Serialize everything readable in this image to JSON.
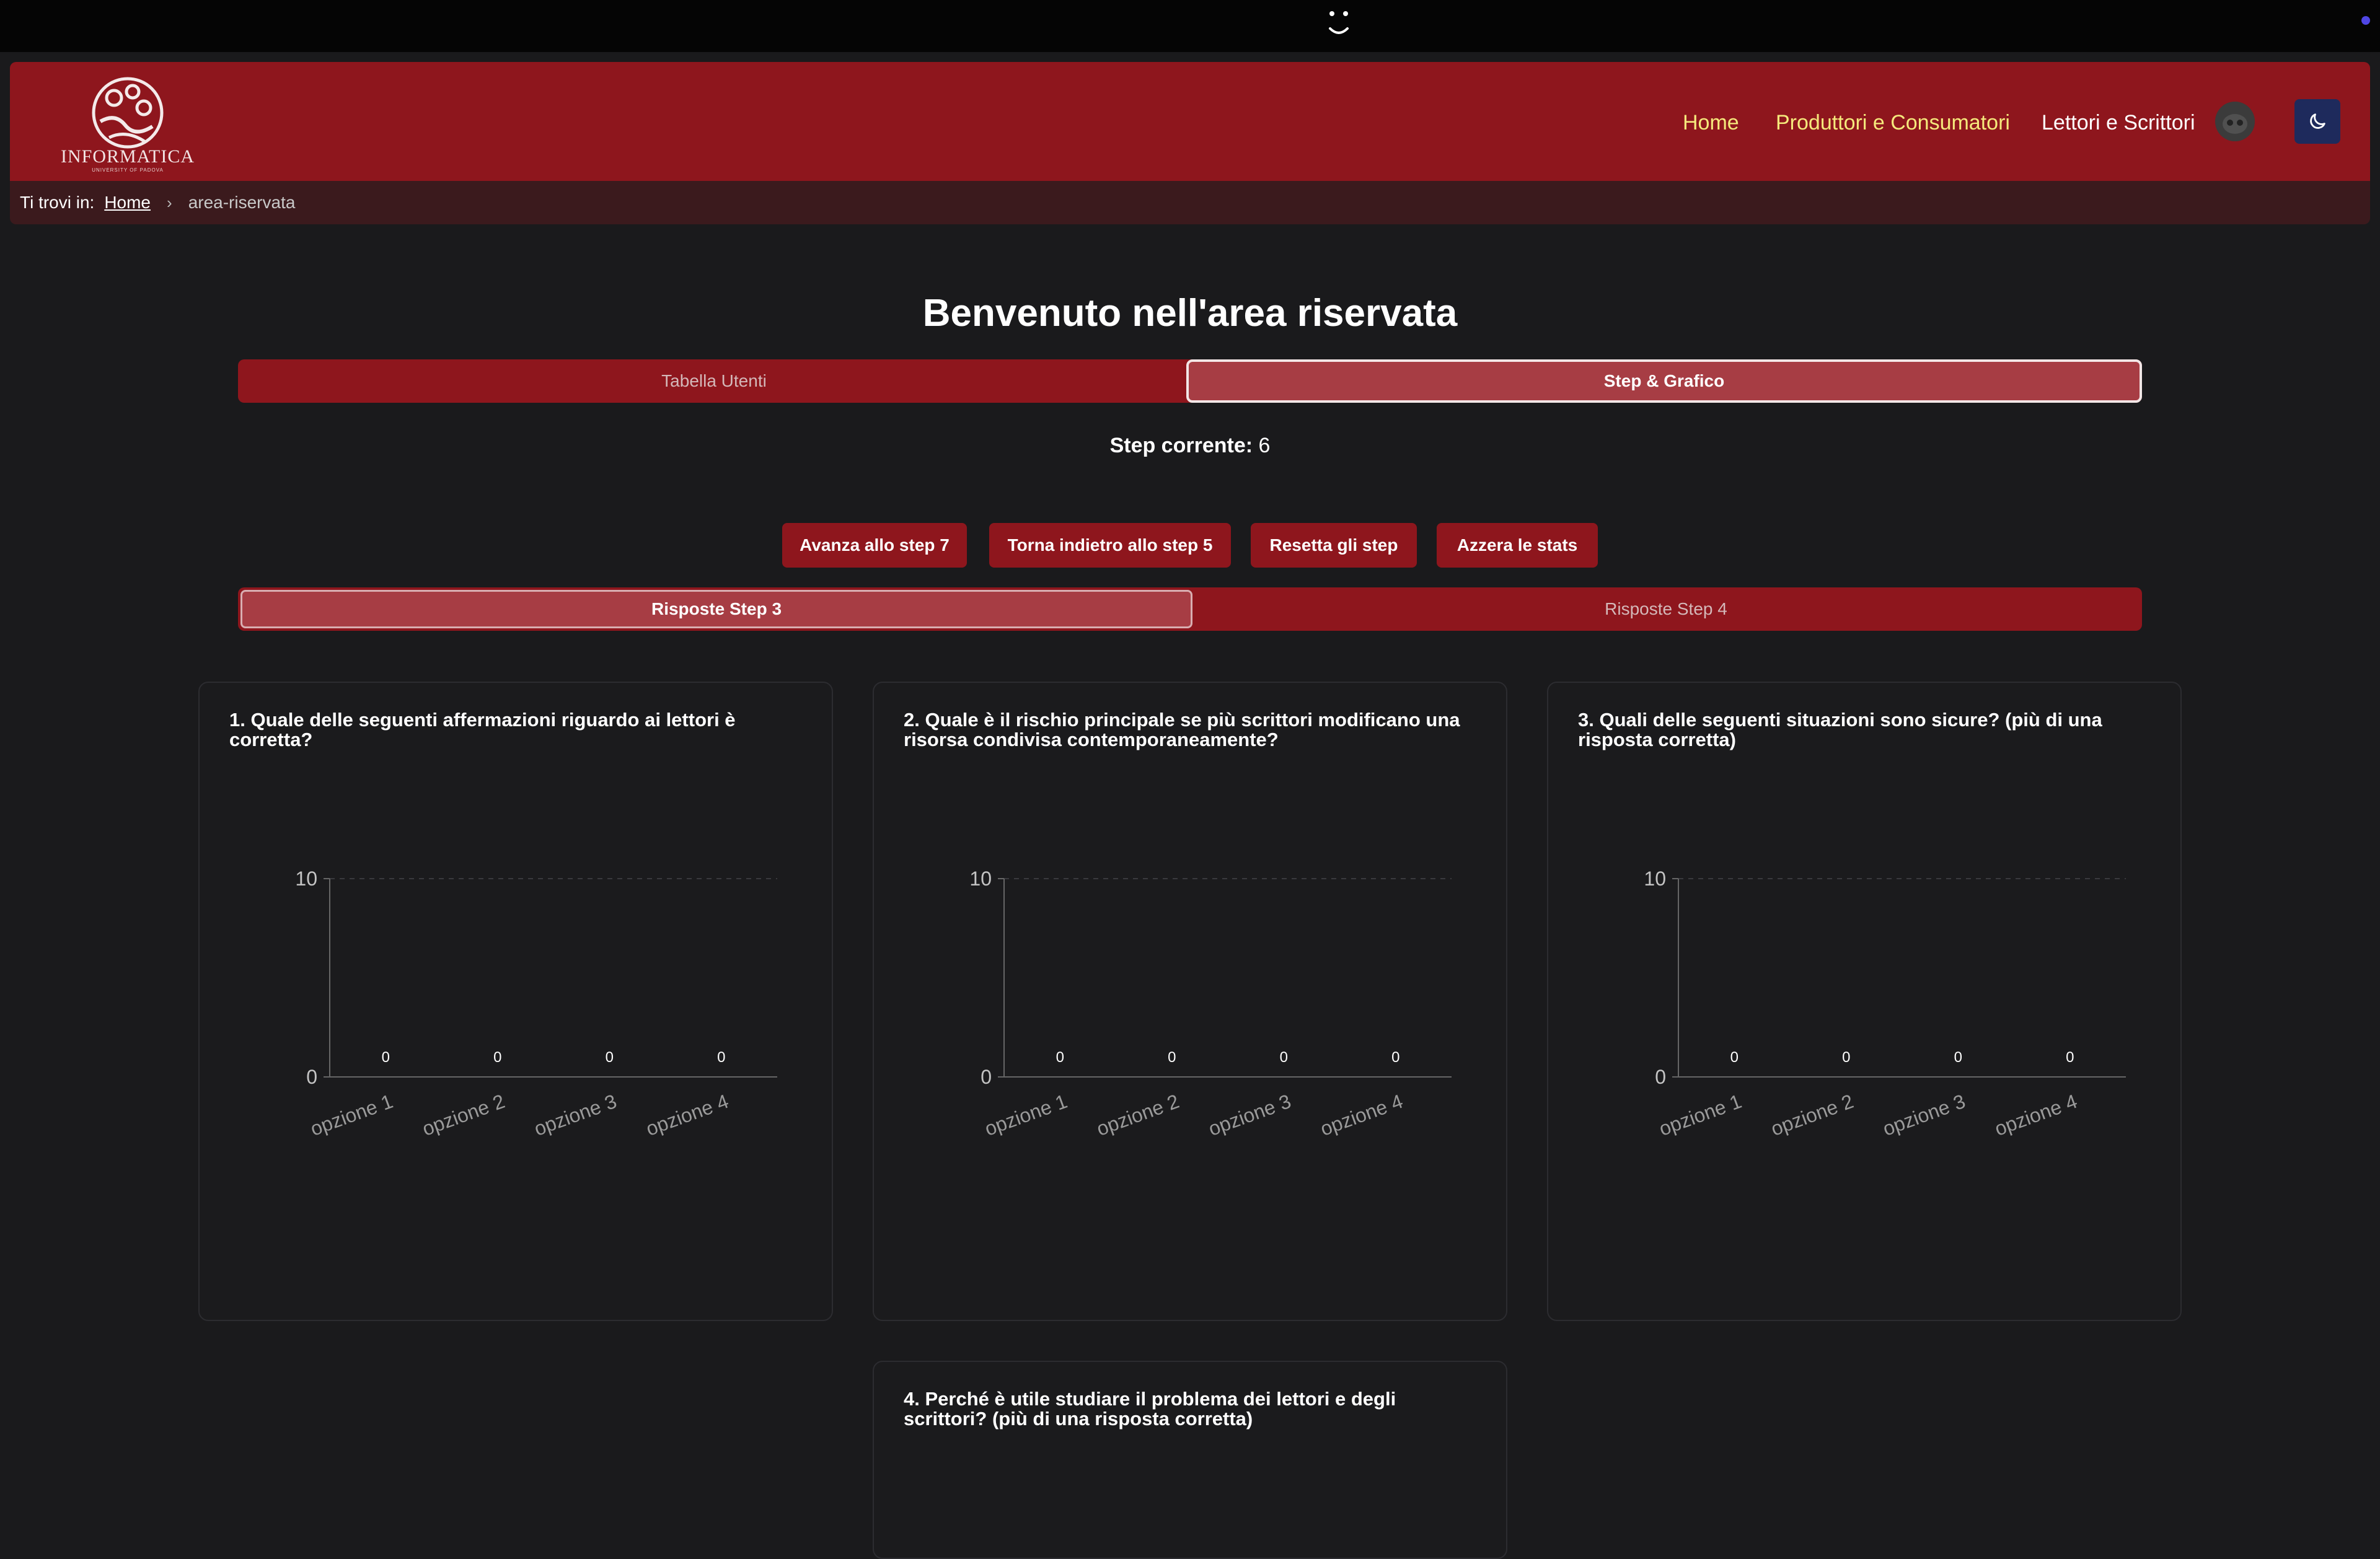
{
  "os": {
    "face_icon": "smiley-face-icon"
  },
  "navbar": {
    "logo_text": "INFORMATICA",
    "logo_subtext": "UNIVERSITY OF PADOVA",
    "links": [
      "Home",
      "Produttori e Consumatori",
      "Lettori e Scrittori"
    ],
    "link_colors": {
      "yellow": "#f5e97c",
      "white": "#ffffff"
    },
    "theme_icon": "moon-icon",
    "accent": "#8e161d"
  },
  "breadcrumb": {
    "prefix": "Ti trovi in:",
    "home": "Home",
    "current": "area-riservata"
  },
  "page": {
    "title": "Benvenuto nell'area riservata",
    "main_tabs": [
      "Tabella Utenti",
      "Step & Grafico"
    ],
    "active_main_tab": "Step & Grafico",
    "step_label": "Step corrente:",
    "step_value": "6",
    "buttons": [
      "Avanza allo step 7",
      "Torna indietro allo step 5",
      "Resetta gli step",
      "Azzera le stats"
    ],
    "response_tabs": [
      "Risposte Step 3",
      "Risposte Step 4"
    ],
    "active_response_tab": "Risposte Step 3"
  },
  "questions": [
    {
      "title": "1. Quale delle seguenti affermazioni riguardo ai lettori è corretta?"
    },
    {
      "title": "2. Quale è il rischio principale se più scrittori modificano una risorsa condivisa contemporaneamente?"
    },
    {
      "title": "3. Quali delle seguenti situazioni sono sicure? (più di una risposta corretta)"
    },
    {
      "title": "4. Perché è utile studiare il problema dei lettori e degli scrittori? (più di una risposta corretta)"
    }
  ],
  "chart_data": [
    {
      "type": "bar",
      "categories": [
        "opzione 1",
        "opzione 2",
        "opzione 3",
        "opzione 4"
      ],
      "values": [
        0,
        0,
        0,
        0
      ],
      "ylim": [
        0,
        10
      ],
      "yticks": [
        0,
        10
      ],
      "grid": true
    },
    {
      "type": "bar",
      "categories": [
        "opzione 1",
        "opzione 2",
        "opzione 3",
        "opzione 4"
      ],
      "values": [
        0,
        0,
        0,
        0
      ],
      "ylim": [
        0,
        10
      ],
      "yticks": [
        0,
        10
      ],
      "grid": true
    },
    {
      "type": "bar",
      "categories": [
        "opzione 1",
        "opzione 2",
        "opzione 3",
        "opzione 4"
      ],
      "values": [
        0,
        0,
        0,
        0
      ],
      "ylim": [
        0,
        10
      ],
      "yticks": [
        0,
        10
      ],
      "grid": true
    }
  ]
}
